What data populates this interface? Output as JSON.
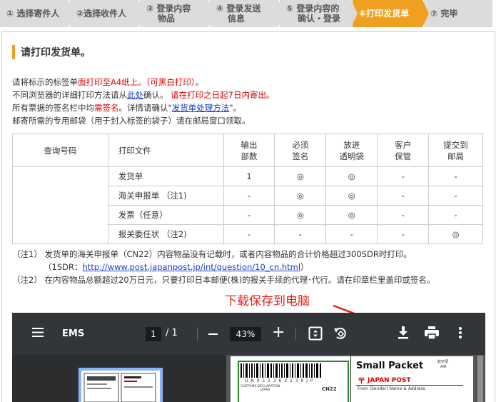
{
  "steps": [
    {
      "label": "① 选择寄件人"
    },
    {
      "label": "②选择收件人"
    },
    {
      "line1": "③ 登录内容",
      "line2": "物品"
    },
    {
      "line1": "④ 登录发送",
      "line2": "信息"
    },
    {
      "line1": "⑤ 登录内容的",
      "line2": "确认・登录"
    },
    {
      "label": "⑥打印发货单"
    },
    {
      "label": "⑦ 完毕"
    }
  ],
  "heading": "请打印发货单。",
  "intro": {
    "l1a": "请将标示的标签单",
    "l1b": "面打印至A4纸上。（可黑白打印）",
    "l1c": "。",
    "l2a": "不同浏览器的详细打印方法请从",
    "l2link": "此处",
    "l2b": "确认。",
    "l2red": "请在打印之日起7日内寄出。",
    "l3a": "所有票据的签名栏中均",
    "l3red": "需签名",
    "l3b": "。详情请确认\"",
    "l3link": "发货单处理方法",
    "l3c": "\"。",
    "l4": "邮寄所需的专用邮袋（用于封入标签的袋子）请在邮局窗口领取。"
  },
  "table": {
    "headers": [
      "查询号码",
      "打印文件",
      "输出\n部数",
      "必须\n签名",
      "放进\n透明袋",
      "客户\n保管",
      "提交到\n邮局"
    ],
    "rows": [
      [
        "发货单",
        "1",
        "◎",
        "◎",
        "-",
        "-"
      ],
      [
        "海关申报单 （注1)",
        "-",
        "◎",
        "◎",
        "-",
        "-"
      ],
      [
        "发票（任意）",
        "-",
        "◎",
        "◎",
        "-",
        "-"
      ],
      [
        "报关委任状 （注2)",
        "-",
        "-",
        "-",
        "-",
        "◎"
      ]
    ]
  },
  "notes": {
    "n1": "（注1） 发货单的海关申报单（CN22）内容物品没有记载时，或者内容物品的合计价格超过300SDR时打印。",
    "n1b_prefix": "（1SDR：",
    "n1b_link": "http://www.post.japanpost.jp/int/question/10_cn.html",
    "n1b_suffix": "）",
    "n2": "（注2） 在内容物品总额超过20万日元，只要打印日本邮便(株)的报关手续的代理･代行。请在印章栏里盖印或签名。"
  },
  "annotation": "下载保存到电脑",
  "viewer": {
    "title": "EMS",
    "page": "1",
    "total": "/ 1",
    "zoom": "43%",
    "doc_title": "Small Packet",
    "doc_brand": "JAPAN POST",
    "doc_air_jp": "航空便",
    "doc_air": "AIR",
    "doc_cn22": "CN22",
    "doc_from": "From (Sender) Name & Address",
    "doc_barcode": "U N 0 5 2 3 6 2 1 3 9 J P",
    "doc_customs": "CUSTOMS DECLARATION",
    "doc_japan": "JAPAN"
  },
  "colors": {
    "accent": "#f0a020",
    "red": "#d00",
    "link": "#1a3cc8"
  }
}
